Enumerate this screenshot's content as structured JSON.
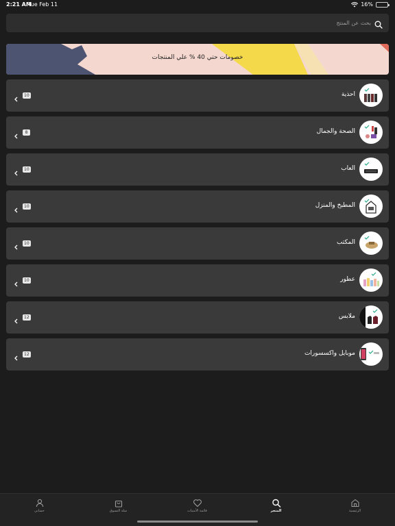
{
  "status": {
    "time": "2:21 AM",
    "date": "Tue Feb 11",
    "battery": "16%",
    "battery_level": 0.16
  },
  "search": {
    "placeholder": "بحث عن المنتج"
  },
  "promo": {
    "text": "خصومات حتي 40 % علي المنتجات"
  },
  "categories": [
    {
      "label": "احذية",
      "count": "10"
    },
    {
      "label": "الصحة والجمال",
      "count": "8"
    },
    {
      "label": "العاب",
      "count": "10"
    },
    {
      "label": "المطبخ والمنزل",
      "count": "10"
    },
    {
      "label": "المكتب",
      "count": "10"
    },
    {
      "label": "عطور",
      "count": "10"
    },
    {
      "label": "ملابس",
      "count": "12"
    },
    {
      "label": "موبايل واكسسورات",
      "count": "12"
    }
  ],
  "tabs": [
    {
      "label": "الرئيسية",
      "icon": "home-icon"
    },
    {
      "label": "المتجر",
      "icon": "search-icon"
    },
    {
      "label": "قائمة الأمنيات",
      "icon": "heart-icon"
    },
    {
      "label": "سلة التسوق",
      "icon": "bag-icon"
    },
    {
      "label": "حسابي",
      "icon": "person-icon"
    }
  ],
  "active_tab": "المتجر",
  "colors": {
    "background": "#1c1c1c",
    "card": "#3a3a3a",
    "search": "#2e2e2e",
    "promo_pink": "#f4d7cf",
    "promo_navy": "#4c5472",
    "promo_yellow": "#f4d94a"
  }
}
